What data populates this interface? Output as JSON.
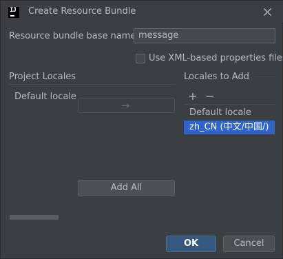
{
  "window": {
    "title": "Create Resource Bundle"
  },
  "form": {
    "base_name_label": "Resource bundle base name:",
    "base_name_value": "message",
    "xml_checkbox_label": "Use XML-based properties files",
    "xml_checkbox_checked": false
  },
  "project_locales": {
    "heading": "Project Locales",
    "items": [
      "Default locale"
    ]
  },
  "locales_to_add": {
    "heading": "Locales to Add",
    "items": [
      "Default locale",
      "zh_CN (中文/中国/)"
    ],
    "selected_index": 1,
    "add_icon": "plus-icon",
    "remove_icon": "minus-icon"
  },
  "transfer": {
    "move_right_icon": "arrow-right-icon",
    "add_all_label": "Add All"
  },
  "footer": {
    "ok_label": "OK",
    "cancel_label": "Cancel"
  },
  "colors": {
    "background": "#3c3f41",
    "selection": "#2f65ca",
    "primary_button": "#365880"
  }
}
